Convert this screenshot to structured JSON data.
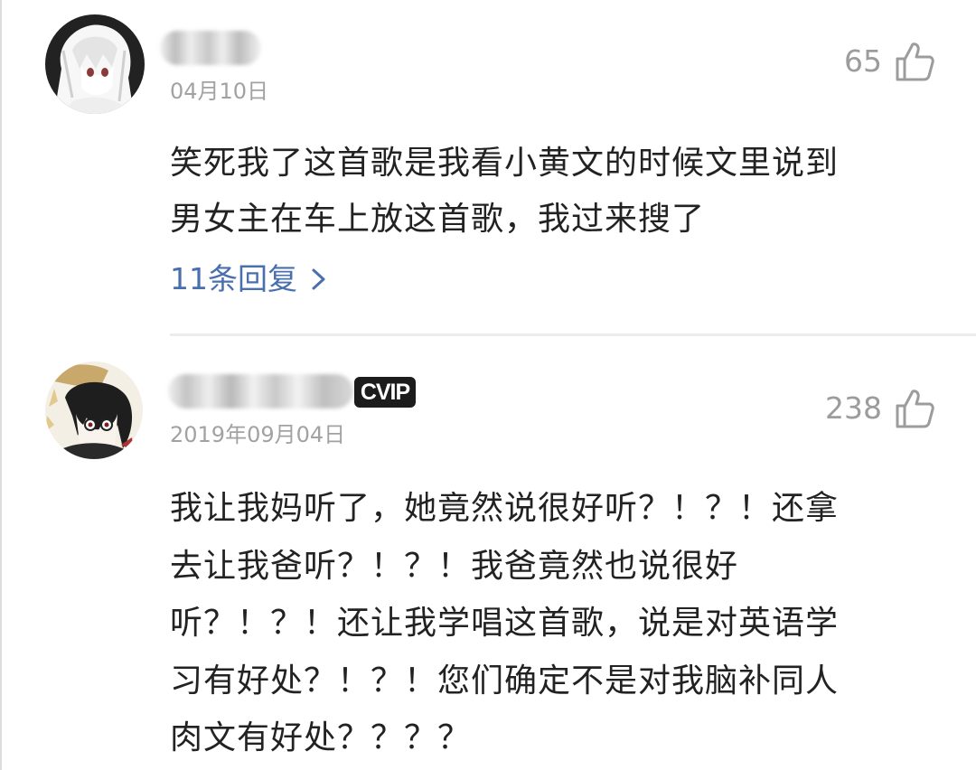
{
  "comments": [
    {
      "avatar": "anime-girl-white-hair-avatar",
      "username_blurred": true,
      "vip_badge": null,
      "date": "04月10日",
      "likes": "65",
      "like_icon": "thumbs-up-icon",
      "lines": [
        "笑死我了这首歌是我看小黄文的时候文里说到",
        "男女主在车上放这首歌，我过来搜了"
      ],
      "replies_label": "11条回复",
      "replies_icon": "chevron-right-icon"
    },
    {
      "avatar": "anime-boy-dark-hair-avatar",
      "username_blurred": true,
      "vip_badge": "CVIP",
      "date": "2019年09月04日",
      "likes": "238",
      "like_icon": "thumbs-up-icon",
      "lines": [
        "我让我妈听了，她竟然说很好听？！？！还拿",
        "去让我爸听？！？！我爸竟然也说很好",
        "听？！？！还让我学唱这首歌，说是对英语学",
        "习有好处？！？！您们确定不是对我脑补同人",
        "肉文有好处？？？？"
      ]
    }
  ],
  "colors": {
    "link_blue": "#4a6fae",
    "meta_gray": "#a2a2a2",
    "text_dark": "#222222",
    "badge_black": "#1c1c1c"
  }
}
